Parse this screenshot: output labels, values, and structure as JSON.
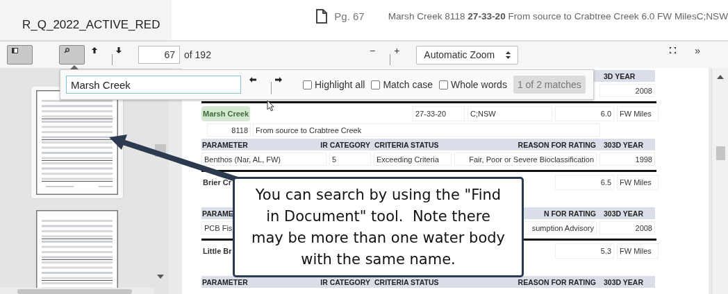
{
  "document_title": "R_Q_2022_ACTIVE_RED",
  "header": {
    "page_label": "Pg. 67",
    "summary": "Marsh Creek 8118 **27-33-20** From source to Crabtree Creek 6.0 FW MilesC;NSW"
  },
  "toolbar": {
    "sidebar_toggle": {
      "pressed": true
    },
    "find_button": {
      "pressed": true
    },
    "page_number": "67",
    "page_count": "of 192",
    "zoom_out": "−",
    "zoom_in": "+",
    "zoom_select": "Automatic Zoom",
    "more": "»"
  },
  "find_bar": {
    "query": "Marsh Creek",
    "options": [
      {
        "label": "Highlight all",
        "checked": false
      },
      {
        "label": "Match case",
        "checked": false
      },
      {
        "label": "Whole words",
        "checked": false
      }
    ],
    "match_count": "1 of 2 matches"
  },
  "sidebar": {
    "thumbnails": [
      {
        "selected": true
      },
      {
        "selected": false
      }
    ]
  },
  "document": {
    "rows": [
      {
        "kind": "param_header",
        "year": "3D YEAR"
      },
      {
        "kind": "param",
        "year": "2008"
      },
      {
        "kind": "divider"
      },
      {
        "kind": "entity",
        "name": "Marsh Creek",
        "highlighted": true,
        "code": "27-33-20",
        "class": "C;NSW",
        "miles": "6.0",
        "unit": "FW Miles"
      },
      {
        "kind": "location",
        "id": "8118",
        "description": "From source to Crabtree Creek"
      },
      {
        "kind": "param_header",
        "parameter": "PARAMETER",
        "ir_category": "IR CATEGORY",
        "criteria_status": "CRITERIA STATUS",
        "reason": "REASON FOR RATING",
        "year": "303D YEAR"
      },
      {
        "kind": "param",
        "parameter": "Benthos (Nar, AL, FW)",
        "ir_category": "5",
        "criteria_status": "Exceeding Criteria",
        "reason": "Fair, Poor or Severe Bioclassification",
        "year": "1998"
      },
      {
        "kind": "divider"
      },
      {
        "kind": "entity",
        "name": "Brier Cr",
        "highlighted": false,
        "miles": "6.5",
        "unit": "FW Miles"
      },
      {
        "kind": "location"
      },
      {
        "kind": "param_header",
        "parameter": "PARAME",
        "reason": "N FOR RATING",
        "year": "303D YEAR"
      },
      {
        "kind": "param",
        "parameter": "PCB Fis",
        "reason": "sumption Advisory",
        "year": "2008"
      },
      {
        "kind": "divider"
      },
      {
        "kind": "entity",
        "name": "Little Br",
        "highlighted": false,
        "miles": "5.3",
        "unit": "FW Miles"
      },
      {
        "kind": "location"
      },
      {
        "kind": "param_header",
        "parameter": "PARAMETER",
        "ir_category": "IR CATEGORY",
        "criteria_status": "CRITERIA STATUS",
        "reason": "REASON FOR RATING",
        "year": "303D YEAR"
      }
    ]
  },
  "callout": {
    "text": "You can search by using the \"Find in Document\" tool.  Note there may be more than one water body with the same name."
  }
}
